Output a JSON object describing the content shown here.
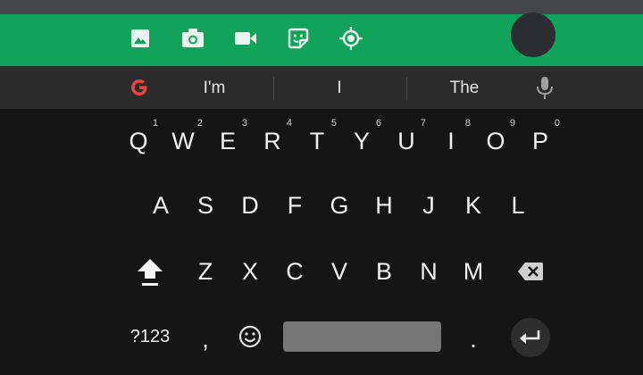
{
  "theme": {
    "accent": "#12a35a",
    "keyboard_bg": "#151515",
    "suggestion_bg": "#2b2b2b",
    "key_text": "#f2f2f2"
  },
  "toolbar": {
    "icons": [
      "image-icon",
      "camera-icon",
      "video-icon",
      "sticker-icon",
      "location-icon"
    ]
  },
  "suggestions": {
    "provider": "G",
    "words": [
      "I'm",
      "I",
      "The"
    ]
  },
  "keyboard": {
    "row1": [
      {
        "label": "Q",
        "num": "1"
      },
      {
        "label": "W",
        "num": "2"
      },
      {
        "label": "E",
        "num": "3"
      },
      {
        "label": "R",
        "num": "4"
      },
      {
        "label": "T",
        "num": "5"
      },
      {
        "label": "Y",
        "num": "6"
      },
      {
        "label": "U",
        "num": "7"
      },
      {
        "label": "I",
        "num": "8"
      },
      {
        "label": "O",
        "num": "9"
      },
      {
        "label": "P",
        "num": "0"
      }
    ],
    "row2": [
      "A",
      "S",
      "D",
      "F",
      "G",
      "H",
      "J",
      "K",
      "L"
    ],
    "row3": [
      "Z",
      "X",
      "C",
      "V",
      "B",
      "N",
      "M"
    ],
    "symbols_label": "?123",
    "comma": ",",
    "period": "."
  }
}
